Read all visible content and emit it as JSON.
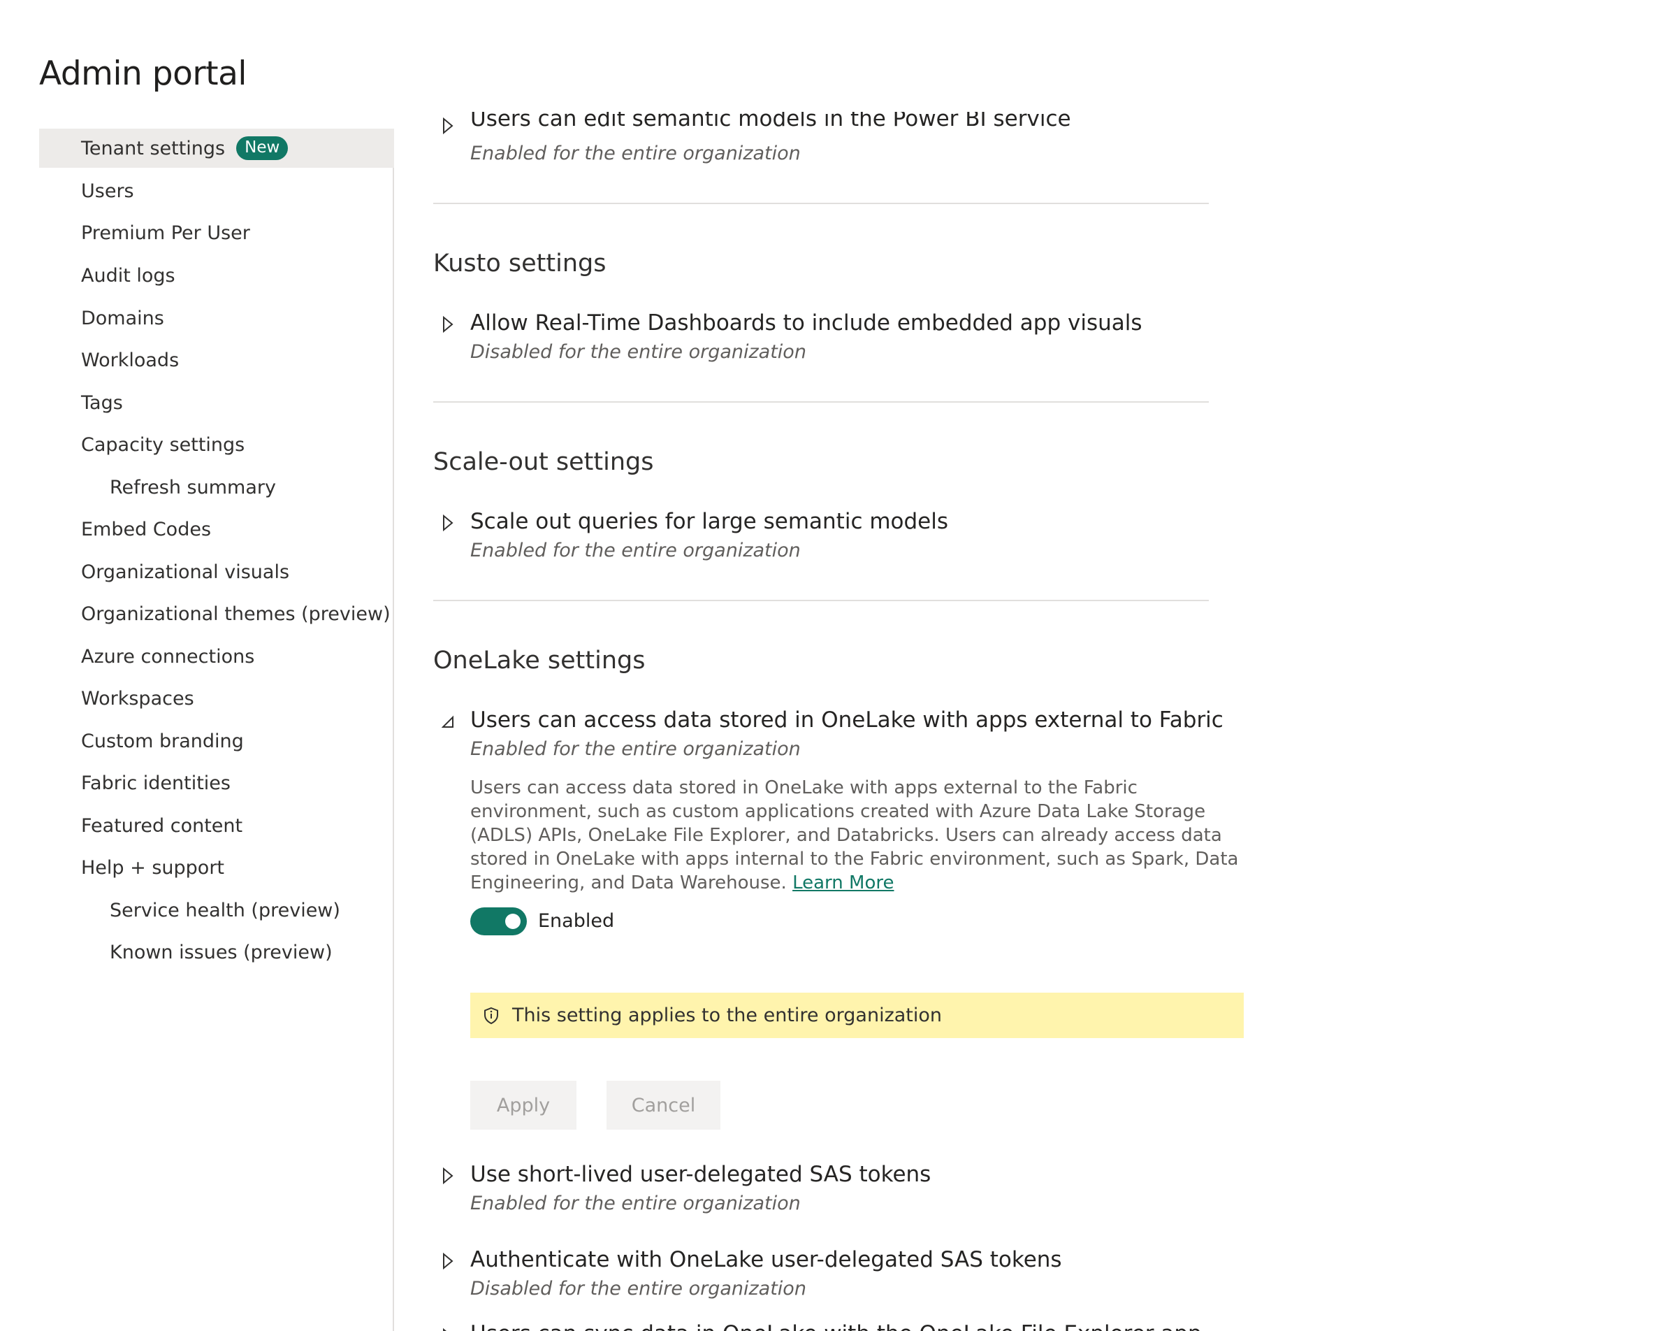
{
  "page": {
    "title": "Admin portal"
  },
  "sidebar": {
    "items": [
      {
        "label": "Tenant settings",
        "badge": "New"
      },
      {
        "label": "Users"
      },
      {
        "label": "Premium Per User"
      },
      {
        "label": "Audit logs"
      },
      {
        "label": "Domains"
      },
      {
        "label": "Workloads"
      },
      {
        "label": "Tags"
      },
      {
        "label": "Capacity settings"
      },
      {
        "label": "Refresh summary"
      },
      {
        "label": "Embed Codes"
      },
      {
        "label": "Organizational visuals"
      },
      {
        "label": "Organizational themes (preview)"
      },
      {
        "label": "Azure connections"
      },
      {
        "label": "Workspaces"
      },
      {
        "label": "Custom branding"
      },
      {
        "label": "Fabric identities"
      },
      {
        "label": "Featured content"
      },
      {
        "label": "Help + support"
      },
      {
        "label": "Service health (preview)"
      },
      {
        "label": "Known issues (preview)"
      }
    ]
  },
  "content": {
    "top_partial": {
      "title": "Users can edit semantic models in the Power BI service",
      "status": "Enabled for the entire organization"
    },
    "kusto": {
      "title": "Kusto settings",
      "settings": [
        {
          "title": "Allow Real-Time Dashboards to include embedded app visuals",
          "status": "Disabled for the entire organization"
        }
      ]
    },
    "scaleout": {
      "title": "Scale-out settings",
      "settings": [
        {
          "title": "Scale out queries for large semantic models",
          "status": "Enabled for the entire organization"
        }
      ]
    },
    "onelake": {
      "title": "OneLake settings",
      "expanded": {
        "title": "Users can access data stored in OneLake with apps external to Fabric",
        "status": "Enabled for the entire organization",
        "description": "Users can access data stored in OneLake with apps external to the Fabric environment, such as custom applications created with Azure Data Lake Storage (ADLS) APIs, OneLake File Explorer, and Databricks. Users can already access data stored in OneLake with apps internal to the Fabric environment, such as Spark, Data Engineering, and Data Warehouse.",
        "learn_more": "Learn More",
        "toggle_label": "Enabled",
        "banner": "This setting applies to the entire organization",
        "apply_label": "Apply",
        "cancel_label": "Cancel"
      },
      "settings": [
        {
          "title": "Use short-lived user-delegated SAS tokens",
          "status": "Enabled for the entire organization"
        },
        {
          "title": "Authenticate with OneLake user-delegated SAS tokens",
          "status": "Disabled for the entire organization"
        }
      ],
      "bottom_partial": {
        "title": "Users can sync data in OneLake with the OneLake File Explorer app"
      }
    }
  },
  "colors": {
    "accent": "#117865",
    "banner": "#fff4ad",
    "active_nav": "#edebe9"
  }
}
